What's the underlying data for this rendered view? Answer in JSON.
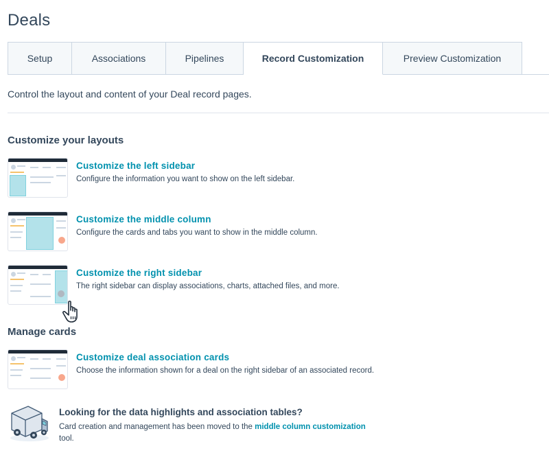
{
  "page": {
    "title": "Deals"
  },
  "tabs": [
    {
      "label": "Setup"
    },
    {
      "label": "Associations"
    },
    {
      "label": "Pipelines"
    },
    {
      "label": "Record Customization",
      "active": true
    },
    {
      "label": "Preview Customization"
    }
  ],
  "intro": "Control the layout and content of your Deal record pages.",
  "layouts": {
    "heading": "Customize your layouts",
    "items": [
      {
        "title": "Customize the left sidebar",
        "description": "Configure the information you want to show on the left sidebar."
      },
      {
        "title": "Customize the middle column",
        "description": "Configure the cards and tabs you want to show in the middle column."
      },
      {
        "title": "Customize the right sidebar",
        "description": "The right sidebar can display associations, charts, attached files, and more."
      }
    ]
  },
  "cards": {
    "heading": "Manage cards",
    "items": [
      {
        "title": "Customize deal association cards",
        "description": "Choose the information shown for a deal on the right sidebar of an associated record."
      }
    ]
  },
  "notice": {
    "title": "Looking for the data highlights and association tables?",
    "body_before": "Card creation and management has been moved to the ",
    "link": "middle column customization",
    "body_after": "tool."
  },
  "colors": {
    "accent": "#0091ae",
    "text": "#33475b",
    "highlight": "#b3e2ea",
    "border": "#cbd6e2"
  },
  "icons": [
    "hand-pointer-cursor-icon",
    "delivery-truck-icon"
  ]
}
